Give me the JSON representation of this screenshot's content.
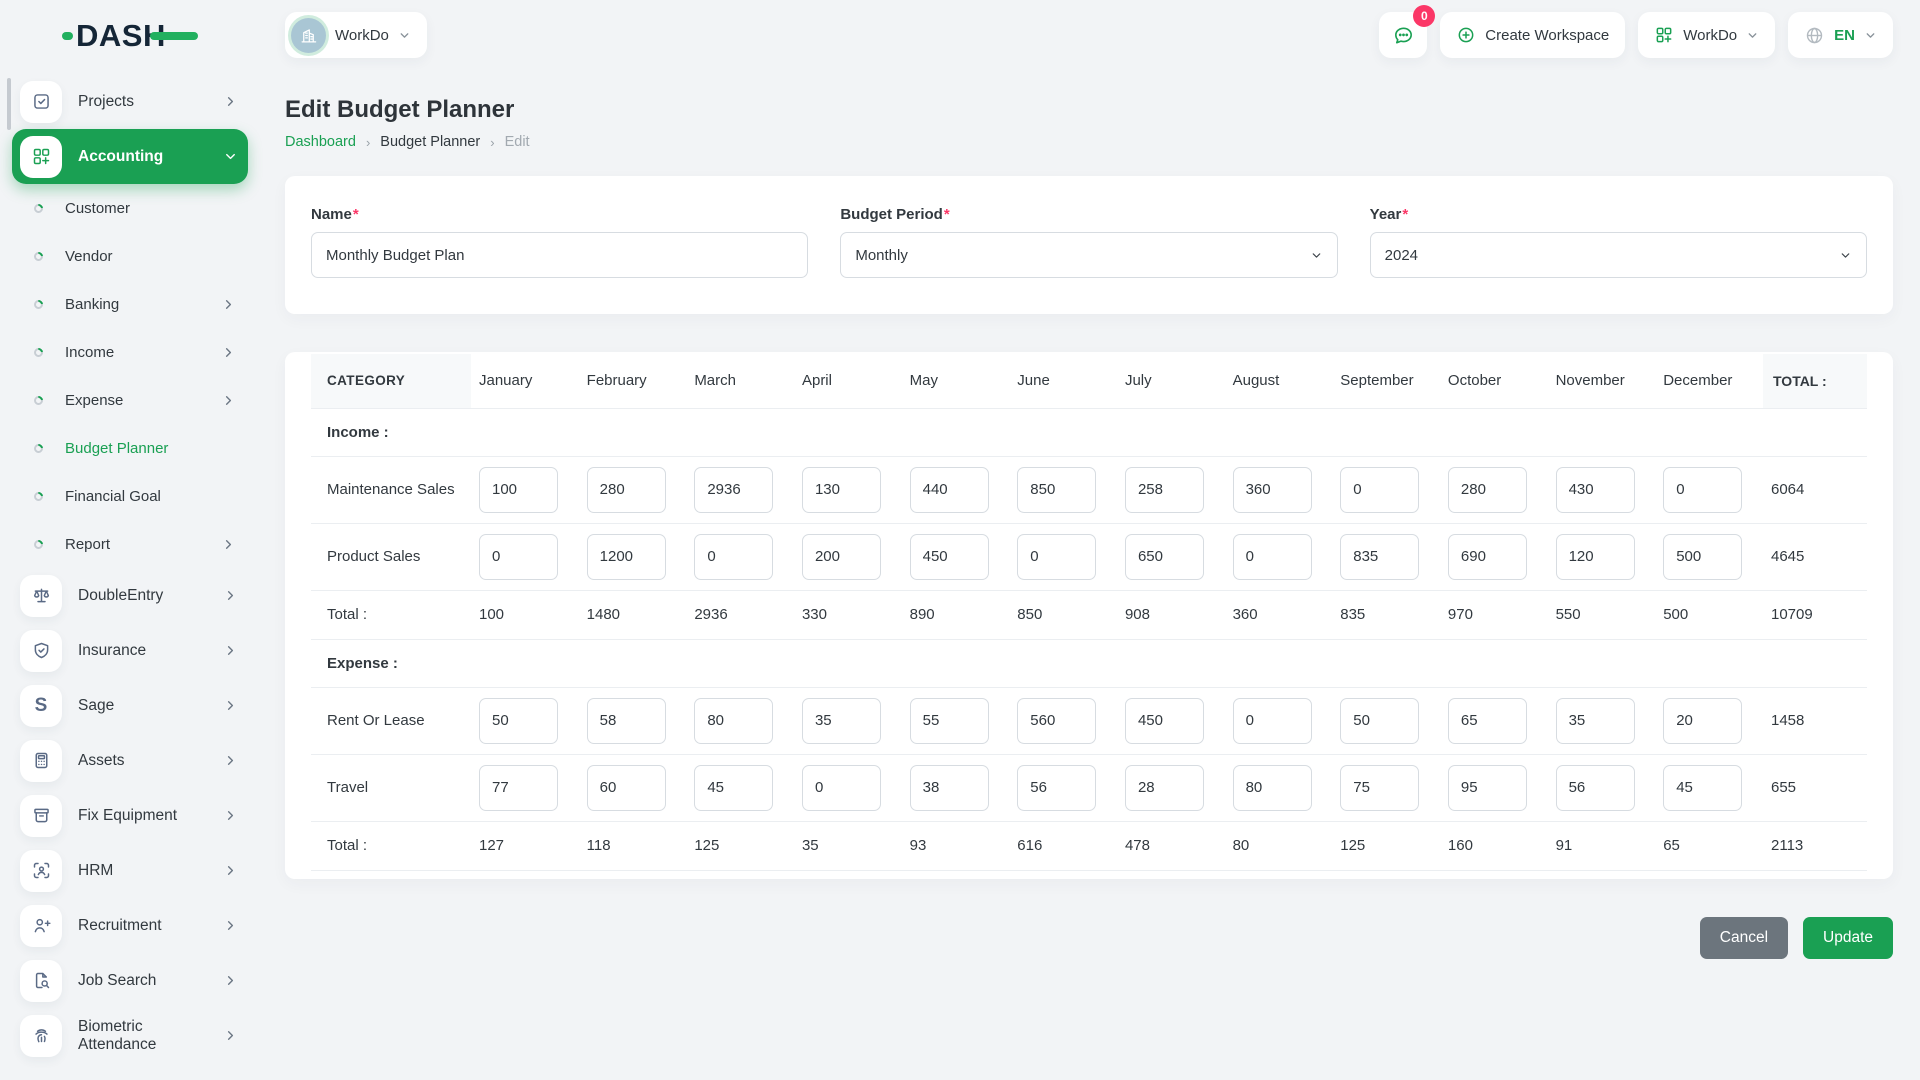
{
  "brand": {
    "logo_text": "DASH",
    "accent": "#22b05f",
    "primary": "#1aa053",
    "ink": "#152637"
  },
  "topbar": {
    "workspace_selector": {
      "label": "WorkDo"
    },
    "messages": {
      "badge": "0"
    },
    "create_workspace": {
      "label": "Create Workspace"
    },
    "workspace_menu": {
      "label": "WorkDo"
    },
    "language": {
      "code": "EN"
    }
  },
  "sidebar": {
    "items": [
      {
        "label": "Projects",
        "icon": "tasks",
        "type": "top",
        "chevron": "right"
      },
      {
        "label": "Accounting",
        "icon": "grid-plus",
        "type": "top",
        "chevron": "down",
        "active": true
      },
      {
        "label": "Customer",
        "type": "sub"
      },
      {
        "label": "Vendor",
        "type": "sub"
      },
      {
        "label": "Banking",
        "type": "sub",
        "chevron": "right"
      },
      {
        "label": "Income",
        "type": "sub",
        "chevron": "right"
      },
      {
        "label": "Expense",
        "type": "sub",
        "chevron": "right"
      },
      {
        "label": "Budget Planner",
        "type": "sub",
        "active": true
      },
      {
        "label": "Financial Goal",
        "type": "sub"
      },
      {
        "label": "Report",
        "type": "sub",
        "chevron": "right"
      },
      {
        "label": "DoubleEntry",
        "icon": "scale",
        "type": "top",
        "chevron": "right"
      },
      {
        "label": "Insurance",
        "icon": "shield-check",
        "type": "top",
        "chevron": "right"
      },
      {
        "label": "Sage",
        "icon": "letter-s",
        "type": "top",
        "chevron": "right"
      },
      {
        "label": "Assets",
        "icon": "calculator",
        "type": "top",
        "chevron": "right"
      },
      {
        "label": "Fix Equipment",
        "icon": "archive-box",
        "type": "top",
        "chevron": "right"
      },
      {
        "label": "HRM",
        "icon": "user-focus",
        "type": "top",
        "chevron": "right"
      },
      {
        "label": "Recruitment",
        "icon": "user-plus",
        "type": "top",
        "chevron": "right"
      },
      {
        "label": "Job Search",
        "icon": "document-search",
        "type": "top",
        "chevron": "right"
      },
      {
        "label": "Biometric Attendance",
        "icon": "fingerprint",
        "type": "top",
        "chevron": "right",
        "wrap": true
      }
    ]
  },
  "page": {
    "title": "Edit Budget Planner",
    "breadcrumb": {
      "0": "Dashboard",
      "1": "Budget Planner",
      "2": "Edit"
    }
  },
  "form": {
    "required_mark": "*",
    "name": {
      "label": "Name",
      "value": "Monthly Budget Plan"
    },
    "budget_period": {
      "label": "Budget Period",
      "value": "Monthly"
    },
    "year": {
      "label": "Year",
      "value": "2024"
    }
  },
  "table": {
    "category_header": "CATEGORY",
    "months": [
      "January",
      "February",
      "March",
      "April",
      "May",
      "June",
      "July",
      "August",
      "September",
      "October",
      "November",
      "December"
    ],
    "total_header": "TOTAL :",
    "sections": [
      {
        "label": "Income :",
        "rows": [
          {
            "name": "Maintenance Sales",
            "values": [
              "100",
              "280",
              "2936",
              "130",
              "440",
              "850",
              "258",
              "360",
              "0",
              "280",
              "430",
              "0"
            ],
            "total": "6064"
          },
          {
            "name": "Product Sales",
            "values": [
              "0",
              "1200",
              "0",
              "200",
              "450",
              "0",
              "650",
              "0",
              "835",
              "690",
              "120",
              "500"
            ],
            "total": "4645"
          }
        ],
        "total_row": {
          "label": "Total :",
          "values": [
            "100",
            "1480",
            "2936",
            "330",
            "890",
            "850",
            "908",
            "360",
            "835",
            "970",
            "550",
            "500"
          ],
          "total": "10709"
        }
      },
      {
        "label": "Expense :",
        "rows": [
          {
            "name": "Rent Or Lease",
            "values": [
              "50",
              "58",
              "80",
              "35",
              "55",
              "560",
              "450",
              "0",
              "50",
              "65",
              "35",
              "20"
            ],
            "total": "1458"
          },
          {
            "name": "Travel",
            "values": [
              "77",
              "60",
              "45",
              "0",
              "38",
              "56",
              "28",
              "80",
              "75",
              "95",
              "56",
              "45"
            ],
            "total": "655"
          }
        ],
        "total_row": {
          "label": "Total :",
          "values": [
            "127",
            "118",
            "125",
            "35",
            "93",
            "616",
            "478",
            "80",
            "125",
            "160",
            "91",
            "65"
          ],
          "total": "2113"
        }
      }
    ]
  },
  "actions": {
    "cancel": "Cancel",
    "update": "Update"
  }
}
